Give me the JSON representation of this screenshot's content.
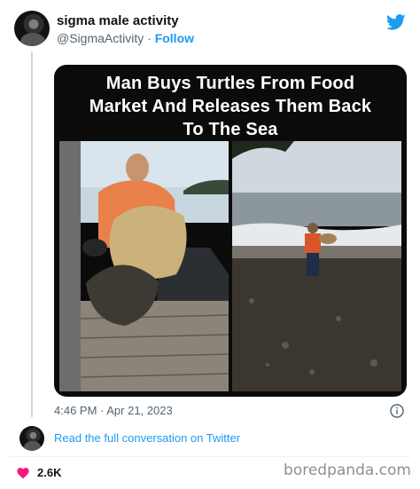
{
  "tweet": {
    "display_name": "sigma male activity",
    "handle": "@SigmaActivity",
    "separator": " · ",
    "follow_label": "Follow",
    "timestamp": "4:46 PM · Apr 21, 2023",
    "likes": "2.6K",
    "reply_link": "Read the full conversation on Twitter"
  },
  "media": {
    "headline": [
      "Man Buys Turtles From Food",
      "Market And Releases Them Back",
      "To The Sea"
    ]
  },
  "icons": {
    "brand": "twitter-bird-icon",
    "info": "info-icon",
    "like": "heart-icon"
  },
  "watermark": "boredpanda.com",
  "colors": {
    "link_blue": "#1d9bf0",
    "heart_red": "#f91880",
    "muted_text": "#536471"
  }
}
